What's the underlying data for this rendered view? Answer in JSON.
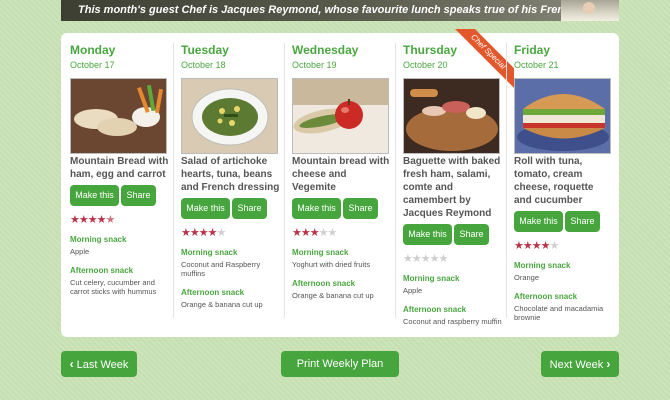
{
  "banner": {
    "text": "This month's guest Chef is Jacques Reymond, whose favourite lunch speaks true of his French roots!"
  },
  "days": [
    {
      "name": "Monday",
      "date": "October 17",
      "dish": "Mountain Bread with ham, egg and carrot",
      "make_label": "Make this",
      "share_label": "Share",
      "rating": 4.5,
      "morning_label": "Morning snack",
      "morning": "Apple",
      "afternoon_label": "Afternoon snack",
      "afternoon": "Cut celery, cucumber and carrot sticks with hummus"
    },
    {
      "name": "Tuesday",
      "date": "October 18",
      "dish": "Salad of artichoke hearts, tuna, beans and French dressing",
      "make_label": "Make this",
      "share_label": "Share",
      "rating": 4,
      "morning_label": "Morning snack",
      "morning": "Coconut and Raspberry muffins",
      "afternoon_label": "Afternoon snack",
      "afternoon": "Orange & banana cut up"
    },
    {
      "name": "Wednesday",
      "date": "October 19",
      "dish": "Mountain bread with cheese and Vegemite",
      "make_label": "Make this",
      "share_label": "Share",
      "rating": 3,
      "morning_label": "Morning snack",
      "morning": "Yoghurt with dried fruits",
      "afternoon_label": "Afternoon snack",
      "afternoon": "Orange & banana cut up"
    },
    {
      "name": "Thursday",
      "date": "October 20",
      "ribbon": "Chef Special",
      "dish": "Baguette with baked fresh ham, salami, comte and camembert by Jacques Reymond",
      "make_label": "Make this",
      "share_label": "Share",
      "rating": 0,
      "morning_label": "Morning snack",
      "morning": "Apple",
      "afternoon_label": "Afternoon snack",
      "afternoon": "Coconut and raspberry muffin"
    },
    {
      "name": "Friday",
      "date": "October 21",
      "dish": "Roll with tuna, tomato, cream cheese, roquette and cucumber",
      "make_label": "Make this",
      "share_label": "Share",
      "rating": 4,
      "morning_label": "Morning snack",
      "morning": "Orange",
      "afternoon_label": "Afternoon snack",
      "afternoon": "Chocolate and macadamia brownie"
    }
  ],
  "nav": {
    "prev_label": "Last Week",
    "print_label": "Print Weekly Plan",
    "next_label": "Next Week"
  },
  "colors": {
    "accent": "#46a63d",
    "ribbon": "#e2572c",
    "star": "#b8344a"
  }
}
